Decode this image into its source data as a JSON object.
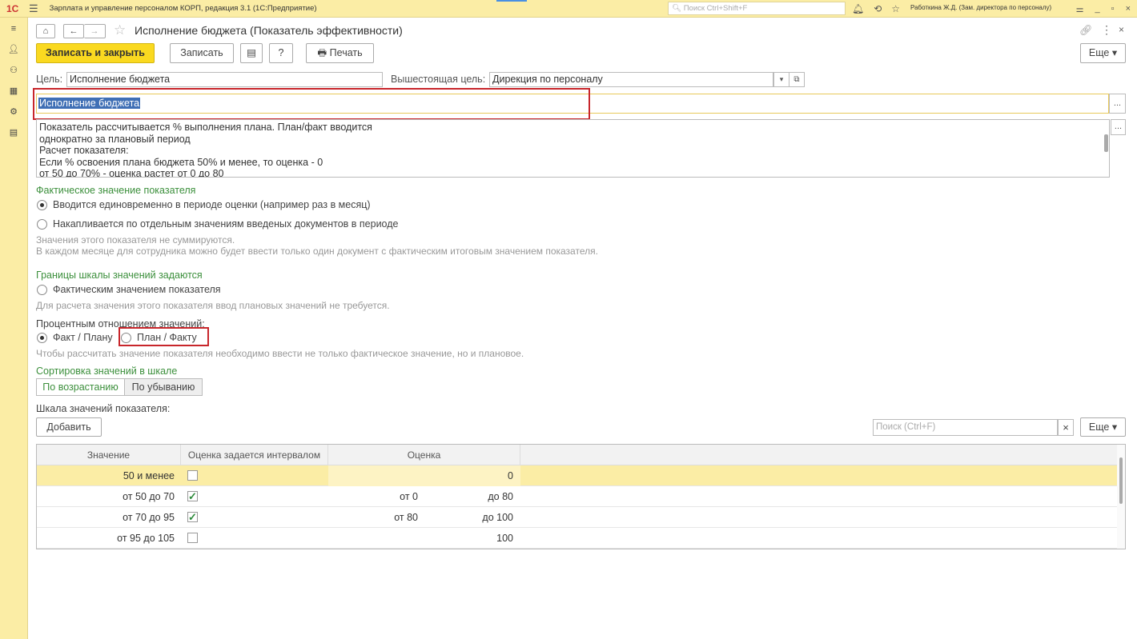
{
  "app": {
    "logo": "1С",
    "title": "Зарплата и управление персоналом КОРП, редакция 3.1  (1С:Предприятие)",
    "search_placeholder": "Поиск Ctrl+Shift+F",
    "user": "Работкина Ж.Д. (Зам. директора по персоналу)"
  },
  "form": {
    "title": "Исполнение бюджета (Показатель эффективности)",
    "buttons": {
      "save_close": "Записать и закрыть",
      "save": "Записать",
      "help": "?",
      "print": "Печать",
      "more": "Еще"
    },
    "goal_label": "Цель:",
    "goal_value": "Исполнение бюджета",
    "parent_goal_label": "Вышестоящая цель:",
    "parent_goal_value": "Дирекция по персоналу",
    "name_value": "Исполнение бюджета",
    "ellipsis": "...",
    "description": [
      "Показатель рассчитывается % выполнения плана. План/факт вводится",
      "однократно за плановый период",
      "Расчет показателя:",
      "Если % освоения плана бюджета 50% и менее, то оценка - 0",
      "от 50 до 70% - оценка растет от 0 до 80"
    ]
  },
  "actual": {
    "section": "Фактическое значение показателя",
    "option1": "Вводится единовременно в периоде оценки (например раз в месяц)",
    "option2": "Накапливается по отдельным значениям введеных документов в периоде",
    "note1": "Значения этого показателя не суммируются.",
    "note2": "В каждом месяце для сотрудника можно будет ввести только один документ с фактическим итоговым значением показателя."
  },
  "bounds": {
    "section": "Границы шкалы значений задаются",
    "option1": "Фактическим значением показателя",
    "note1": "Для расчета значения этого показателя ввод плановых значений не требуется.",
    "percent_label": "Процентным отношением значений:",
    "fact_plan": "Факт / Плану",
    "plan_fact": "План / Факту",
    "note2": "Чтобы рассчитать значение показателя необходимо ввести не только фактическое значение, но и плановое."
  },
  "sorting": {
    "section": "Сортировка значений в шкале",
    "asc": "По возрастанию",
    "desc": "По убыванию"
  },
  "scale": {
    "label": "Шкала значений показателя:",
    "add": "Добавить",
    "search_placeholder": "Поиск (Ctrl+F)",
    "clear": "×",
    "more": "Еще",
    "columns": [
      "Значение",
      "Оценка задается интервалом",
      "Оценка"
    ],
    "rows": [
      {
        "value": "50 и менее",
        "interval": false,
        "from": "",
        "to": "0"
      },
      {
        "value": "от 50 до 70",
        "interval": true,
        "from": "от 0",
        "to": "до 80"
      },
      {
        "value": "от 70 до 95",
        "interval": true,
        "from": "от 80",
        "to": "до 100"
      },
      {
        "value": "от 95 до 105",
        "interval": false,
        "from": "",
        "to": "100"
      }
    ]
  },
  "colors": {
    "accent_yellow": "#fad920",
    "panel_yellow": "#fbeda5",
    "section_green": "#3b8f3b",
    "highlight_red": "#c8262b"
  }
}
